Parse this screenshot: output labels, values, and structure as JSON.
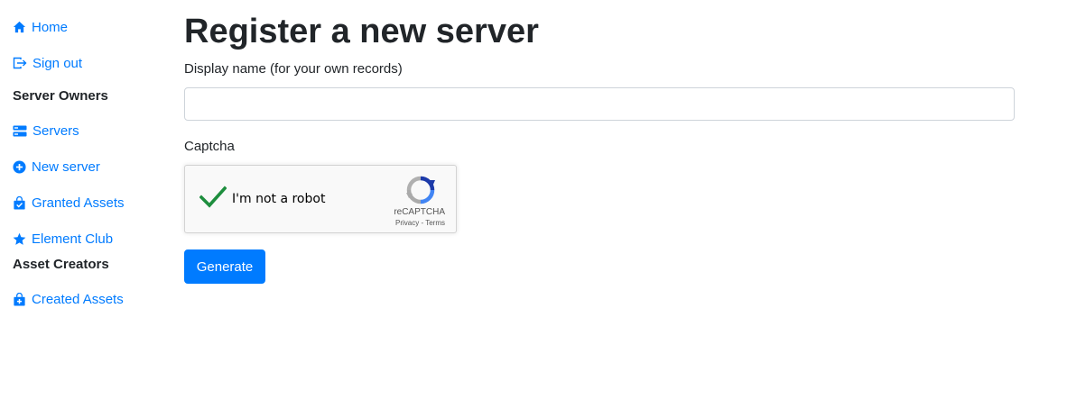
{
  "colors": {
    "link": "#007bff",
    "primary": "#007bff",
    "text": "#212529",
    "check": "#1e8e3e"
  },
  "sidebar": {
    "items": [
      {
        "type": "link",
        "label": "Home",
        "icon": "home-icon"
      },
      {
        "type": "link",
        "label": "Sign out",
        "icon": "sign-out-icon"
      },
      {
        "type": "heading",
        "label": "Server Owners"
      },
      {
        "type": "link",
        "label": "Servers",
        "icon": "server-icon"
      },
      {
        "type": "link",
        "label": "New server",
        "icon": "plus-circle-icon"
      },
      {
        "type": "link",
        "label": "Granted Assets",
        "icon": "shopping-bag-check-icon"
      },
      {
        "type": "link",
        "label": "Element Club",
        "icon": "star-icon"
      },
      {
        "type": "heading",
        "label": "Asset Creators"
      },
      {
        "type": "link",
        "label": "Created Assets",
        "icon": "shopping-bag-plus-icon"
      }
    ]
  },
  "main": {
    "title": "Register a new server",
    "display_name": {
      "label": "Display name (for your own records)",
      "value": "",
      "placeholder": ""
    },
    "captcha": {
      "label": "Captcha",
      "checkbox_label": "I'm not a robot",
      "checked": true,
      "brand": "reCAPTCHA",
      "privacy": "Privacy",
      "separator": "-",
      "terms": "Terms"
    },
    "submit_label": "Generate"
  }
}
